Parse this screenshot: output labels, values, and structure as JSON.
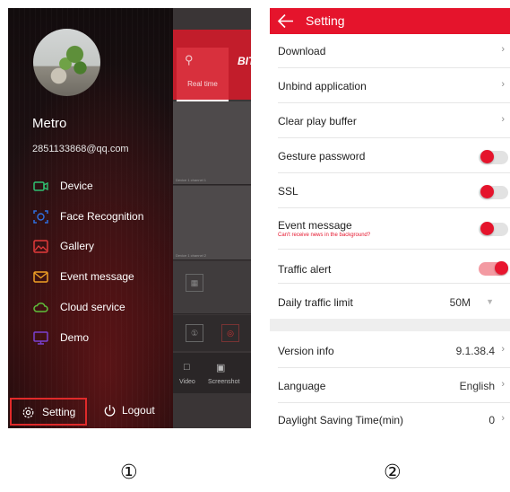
{
  "drawer": {
    "user": {
      "name": "Metro",
      "email": "2851133868@qq.com"
    },
    "menu": [
      {
        "label": "Device",
        "icon": "video-camera-icon",
        "color": "#2fbf71"
      },
      {
        "label": "Face Recognition",
        "icon": "face-recognition-icon",
        "color": "#2f6fe0"
      },
      {
        "label": "Gallery",
        "icon": "gallery-icon",
        "color": "#e23a3a"
      },
      {
        "label": "Event message",
        "icon": "mail-icon",
        "color": "#f0a024"
      },
      {
        "label": "Cloud service",
        "icon": "cloud-icon",
        "color": "#5fbf3a"
      },
      {
        "label": "Demo",
        "icon": "demo-screen-icon",
        "color": "#7a40d0"
      }
    ],
    "bottom": {
      "setting_label": "Setting",
      "logout_label": "Logout"
    }
  },
  "background_app": {
    "tab_label": "Real time",
    "brand": "BIT",
    "cell_caption_1": "Device 1 channel 1",
    "cell_caption_2": "Device 1 channel 2",
    "video_label": "Video",
    "screenshot_label": "Screenshot"
  },
  "settings": {
    "title": "Setting",
    "rows": [
      {
        "label": "Download",
        "type": "link"
      },
      {
        "label": "Unbind application",
        "type": "link"
      },
      {
        "label": "Clear play buffer",
        "type": "link"
      },
      {
        "label": "Gesture password",
        "type": "toggle",
        "state": "off"
      },
      {
        "label": "SSL",
        "type": "toggle",
        "state": "off"
      },
      {
        "label": "Event message",
        "sublabel": "Can't receive news in the background?",
        "type": "toggle",
        "state": "off"
      },
      {
        "label": "Traffic alert",
        "type": "toggle",
        "state": "on"
      },
      {
        "label": "Daily traffic limit",
        "type": "dropdown",
        "value": "50M"
      },
      {
        "label": "Version info",
        "type": "link",
        "value": "9.1.38.4"
      },
      {
        "label": "Language",
        "type": "link",
        "value": "English"
      },
      {
        "label": "Daylight Saving Time(min)",
        "type": "link",
        "value": "0"
      }
    ]
  },
  "captions": {
    "panel1": "①",
    "panel2": "②"
  },
  "colors": {
    "accent": "#e5142c",
    "highlight_border": "#e02a2a"
  }
}
